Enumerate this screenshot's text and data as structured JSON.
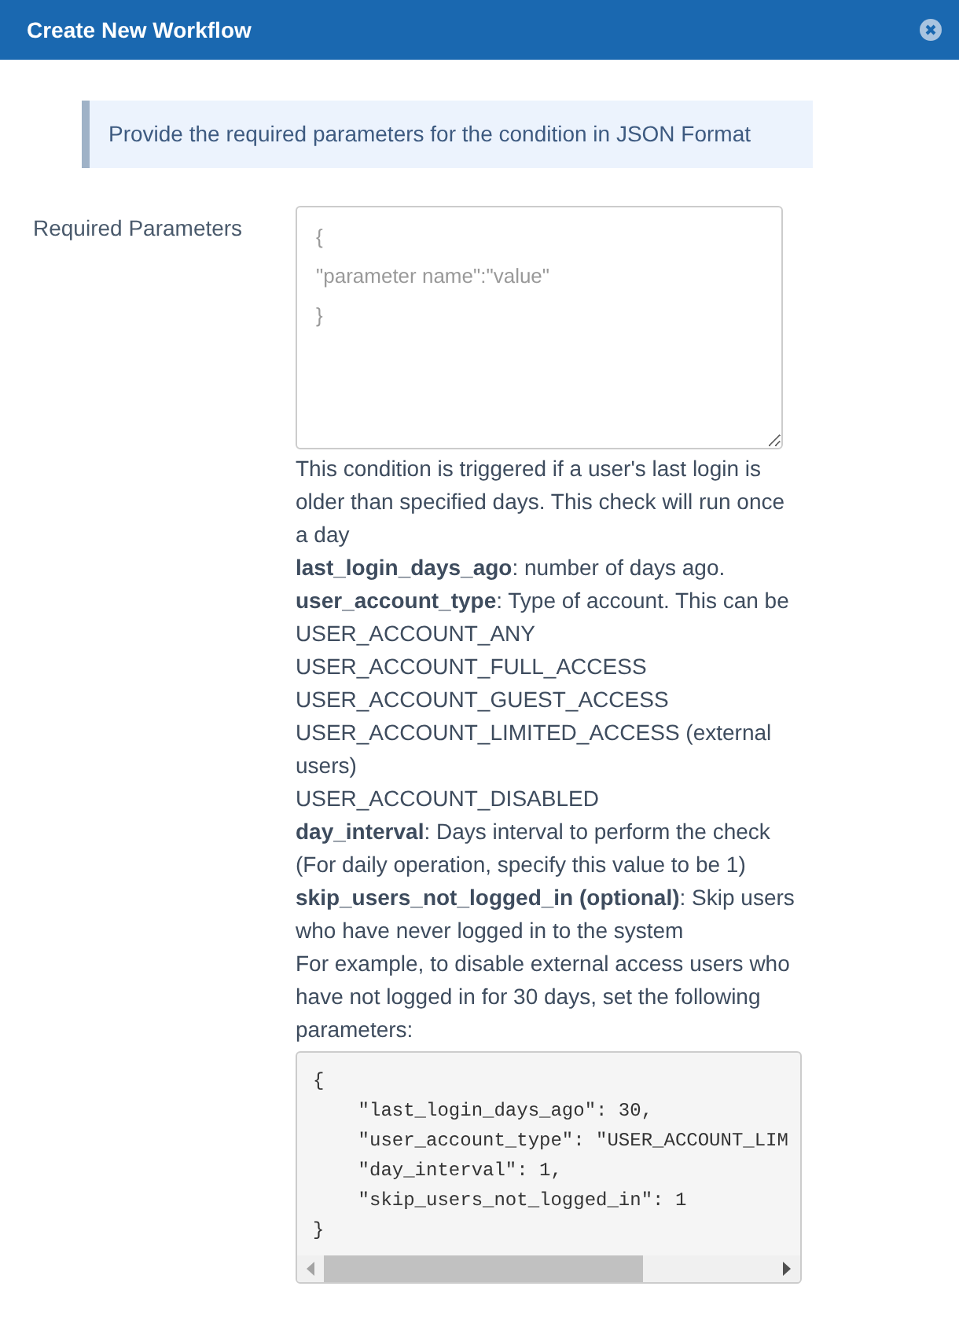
{
  "window": {
    "title": "Create New Workflow"
  },
  "notice": "Provide the required parameters for the condition in JSON Format",
  "field": {
    "label": "Required Parameters",
    "placeholder": "{\n\"parameter name\":\"value\"\n}"
  },
  "help": [
    "This condition is triggered if a user's last login is older than specified days. This check will run once a day",
    "**last_login_days_ago**: number of days ago.",
    "**user_account_type**: Type of account. This can be",
    "USER_ACCOUNT_ANY",
    "USER_ACCOUNT_FULL_ACCESS",
    "USER_ACCOUNT_GUEST_ACCESS",
    "USER_ACCOUNT_LIMITED_ACCESS (external users)",
    "USER_ACCOUNT_DISABLED",
    "**day_interval**: Days interval to perform the check (For daily operation, specify this value to be 1)",
    "**skip_users_not_logged_in (optional)**: Skip users who have never logged in to the system",
    "For example, to disable external access users who have not logged in for 30 days, set the following parameters:"
  ],
  "code": [
    "{",
    "    \"last_login_days_ago\": 30,",
    "    \"user_account_type\": \"USER_ACCOUNT_LIM",
    "    \"day_interval\": 1,",
    "    \"skip_users_not_logged_in\": 1",
    "}"
  ]
}
